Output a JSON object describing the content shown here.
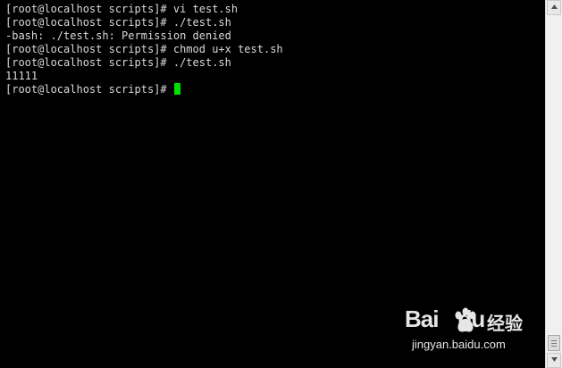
{
  "terminal": {
    "lines": [
      "[root@localhost scripts]# vi test.sh",
      "[root@localhost scripts]# ./test.sh",
      "-bash: ./test.sh: Permission denied",
      "[root@localhost scripts]# chmod u+x test.sh",
      "[root@localhost scripts]# ./test.sh",
      "11111",
      "[root@localhost scripts]# "
    ],
    "text_color": "#d9d9d9",
    "background": "#000000",
    "cursor_color": "#00e000"
  },
  "watermark": {
    "logo_text": "Bai",
    "logo_suffix": "du",
    "chinese_text": "经验",
    "url": "jingyan.baidu.com"
  },
  "scrollbar": {
    "icons": [
      "scroll-up-arrow-icon",
      "scroll-down-arrow-icon"
    ]
  }
}
